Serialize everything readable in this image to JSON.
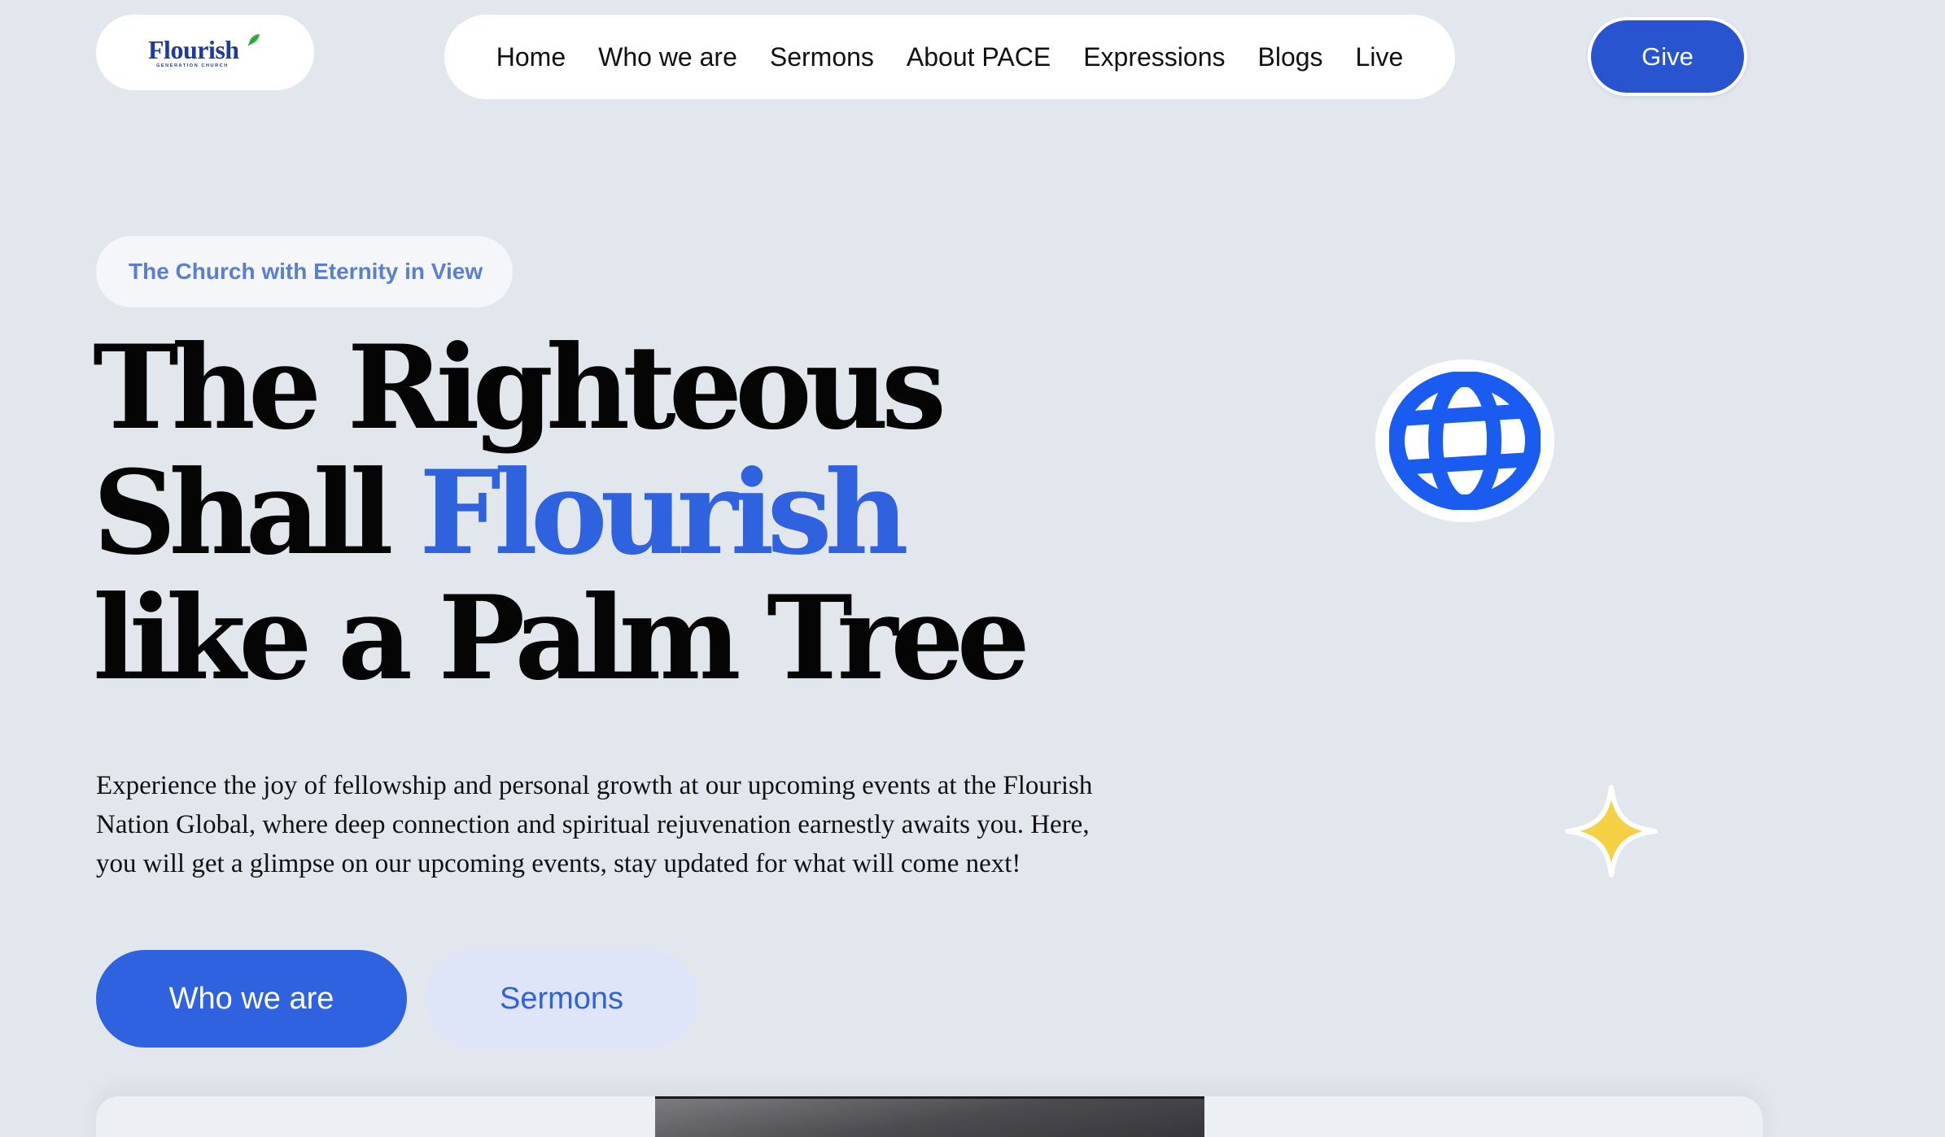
{
  "header": {
    "logo": {
      "word": "Flourish",
      "subtitle": "GENERATION CHURCH",
      "brand_color": "#1e3a9e",
      "leaf_color": "#3bb54a"
    },
    "nav": [
      {
        "label": "Home"
      },
      {
        "label": "Who we are"
      },
      {
        "label": "Sermons"
      },
      {
        "label": "About PACE"
      },
      {
        "label": "Expressions"
      },
      {
        "label": "Blogs"
      },
      {
        "label": "Live"
      }
    ],
    "give_label": "Give"
  },
  "hero": {
    "tagline": "The Church with Eternity in View",
    "title_line1": "The Righteous",
    "title_line2_a": "Shall",
    "title_line2_b": "Flourish",
    "title_line3": "like a Palm Tree",
    "description": "Experience the joy of fellowship and personal growth at our upcoming events at the Flourish Nation Global, where deep connection and spiritual rejuvenation earnestly awaits you. Here, you will get a glimpse on our upcoming events, stay updated for what will come next!",
    "primary_button": "Who we are",
    "secondary_button": "Sermons"
  },
  "decorations": {
    "globe_icon": "globe-icon",
    "sparkle_icon": "sparkle-icon"
  },
  "colors": {
    "background": "#e2e7ee",
    "accent": "#2f62de",
    "give_button": "#2855cf",
    "tagline_text": "#5a7fd1",
    "globe": "#1a5cf0",
    "sparkle": "#f5cf44"
  }
}
